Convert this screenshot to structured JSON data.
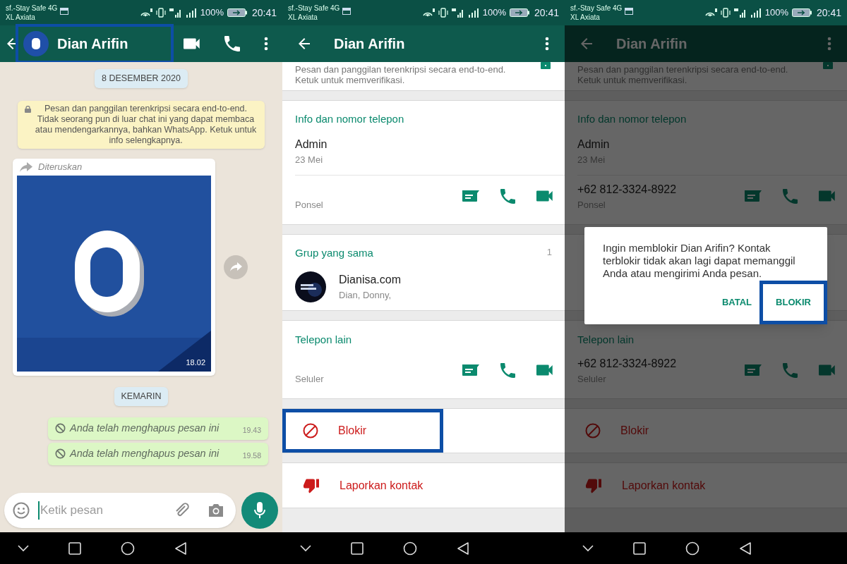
{
  "panels": [
    {
      "kind": "chat",
      "status_bar": {
        "carrier": "sf.-Stay Safe 4G",
        "network": "XL Axiata",
        "battery": "100%",
        "time": "20:41"
      },
      "header": {
        "title": "Dian Arifin",
        "highlighted": true
      },
      "messages": [
        {
          "kind": "date",
          "text": "8 DESEMBER 2020"
        },
        {
          "kind": "notice",
          "text": "Pesan dan panggilan terenkripsi secara end-to-end. Tidak seorang pun di luar chat ini yang dapat membaca atau mendengarkannya, bahkan WhatsApp. Ketuk untuk info selengkapnya."
        },
        {
          "label": "Diteruskan",
          "time": "18.02"
        },
        {
          "kind": "date",
          "text": "KEMARIN"
        },
        {
          "kind": "deleted",
          "text": "Anda telah menghapus pesan ini",
          "time": "19.43"
        },
        {
          "kind": "deleted",
          "text": "Anda telah menghapus pesan ini",
          "time": "19.58"
        }
      ],
      "composer": {
        "placeholder": "Ketik pesan"
      }
    },
    {
      "kind": "info",
      "status_bar": {
        "carrier": "sf.-Stay Safe 4G",
        "network": "XL Axiata",
        "battery": "100%",
        "time": "20:41"
      },
      "header": {
        "title": "Dian Arifin"
      },
      "encryption": "Pesan dan panggilan terenkripsi secara end-to-end. Ketuk untuk memverifikasi.",
      "sections": [
        {
          "kind": "about",
          "title": "Info dan nomor telepon",
          "about": "Admin",
          "date": "23 Mei",
          "phone_type": "Ponsel"
        },
        {
          "kind": "groups",
          "title": "Grup yang sama",
          "count": "1",
          "items": [
            {
              "name": "Dianisa.com",
              "members": "Dian, Donny,"
            }
          ]
        },
        {
          "kind": "phones",
          "title": "Telepon lain",
          "phone_type": "Seluler"
        },
        {
          "kind": "block",
          "label": "Blokir",
          "highlighted": true
        },
        {
          "kind": "report",
          "label": "Laporkan kontak",
          "highlighted": false
        }
      ],
      "dimmed": false
    },
    {
      "kind": "info",
      "status_bar": {
        "carrier": "sf.-Stay Safe 4G",
        "network": "XL Axiata",
        "battery": "100%",
        "time": "20:41"
      },
      "header": {
        "title": "Dian Arifin"
      },
      "encryption": "Pesan dan panggilan terenkripsi secara end-to-end. Ketuk untuk memverifikasi.",
      "sections": [
        {
          "kind": "about",
          "title": "Info dan nomor telepon",
          "about": "Admin",
          "date": "23 Mei",
          "phone": "+62 812-3324-8922",
          "phone_type": "Ponsel"
        },
        {
          "kind": "groups"
        },
        {
          "kind": "phones",
          "title": "Telepon lain",
          "phone": "+62 812-3324-8922",
          "phone_type": "Seluler"
        },
        {
          "kind": "block",
          "label": "Blokir",
          "highlighted": false
        },
        {
          "kind": "report",
          "label": "Laporkan kontak",
          "highlighted": false
        }
      ],
      "dimmed": true,
      "dialog": {
        "text": "Ingin memblokir Dian Arifin? Kontak terblokir tidak akan lagi dapat memanggil Anda atau mengirimi Anda pesan.",
        "buttons": [
          {
            "label": "BATAL",
            "highlighted": false
          },
          {
            "label": "BLOKIR",
            "highlighted": true
          }
        ]
      }
    }
  ]
}
